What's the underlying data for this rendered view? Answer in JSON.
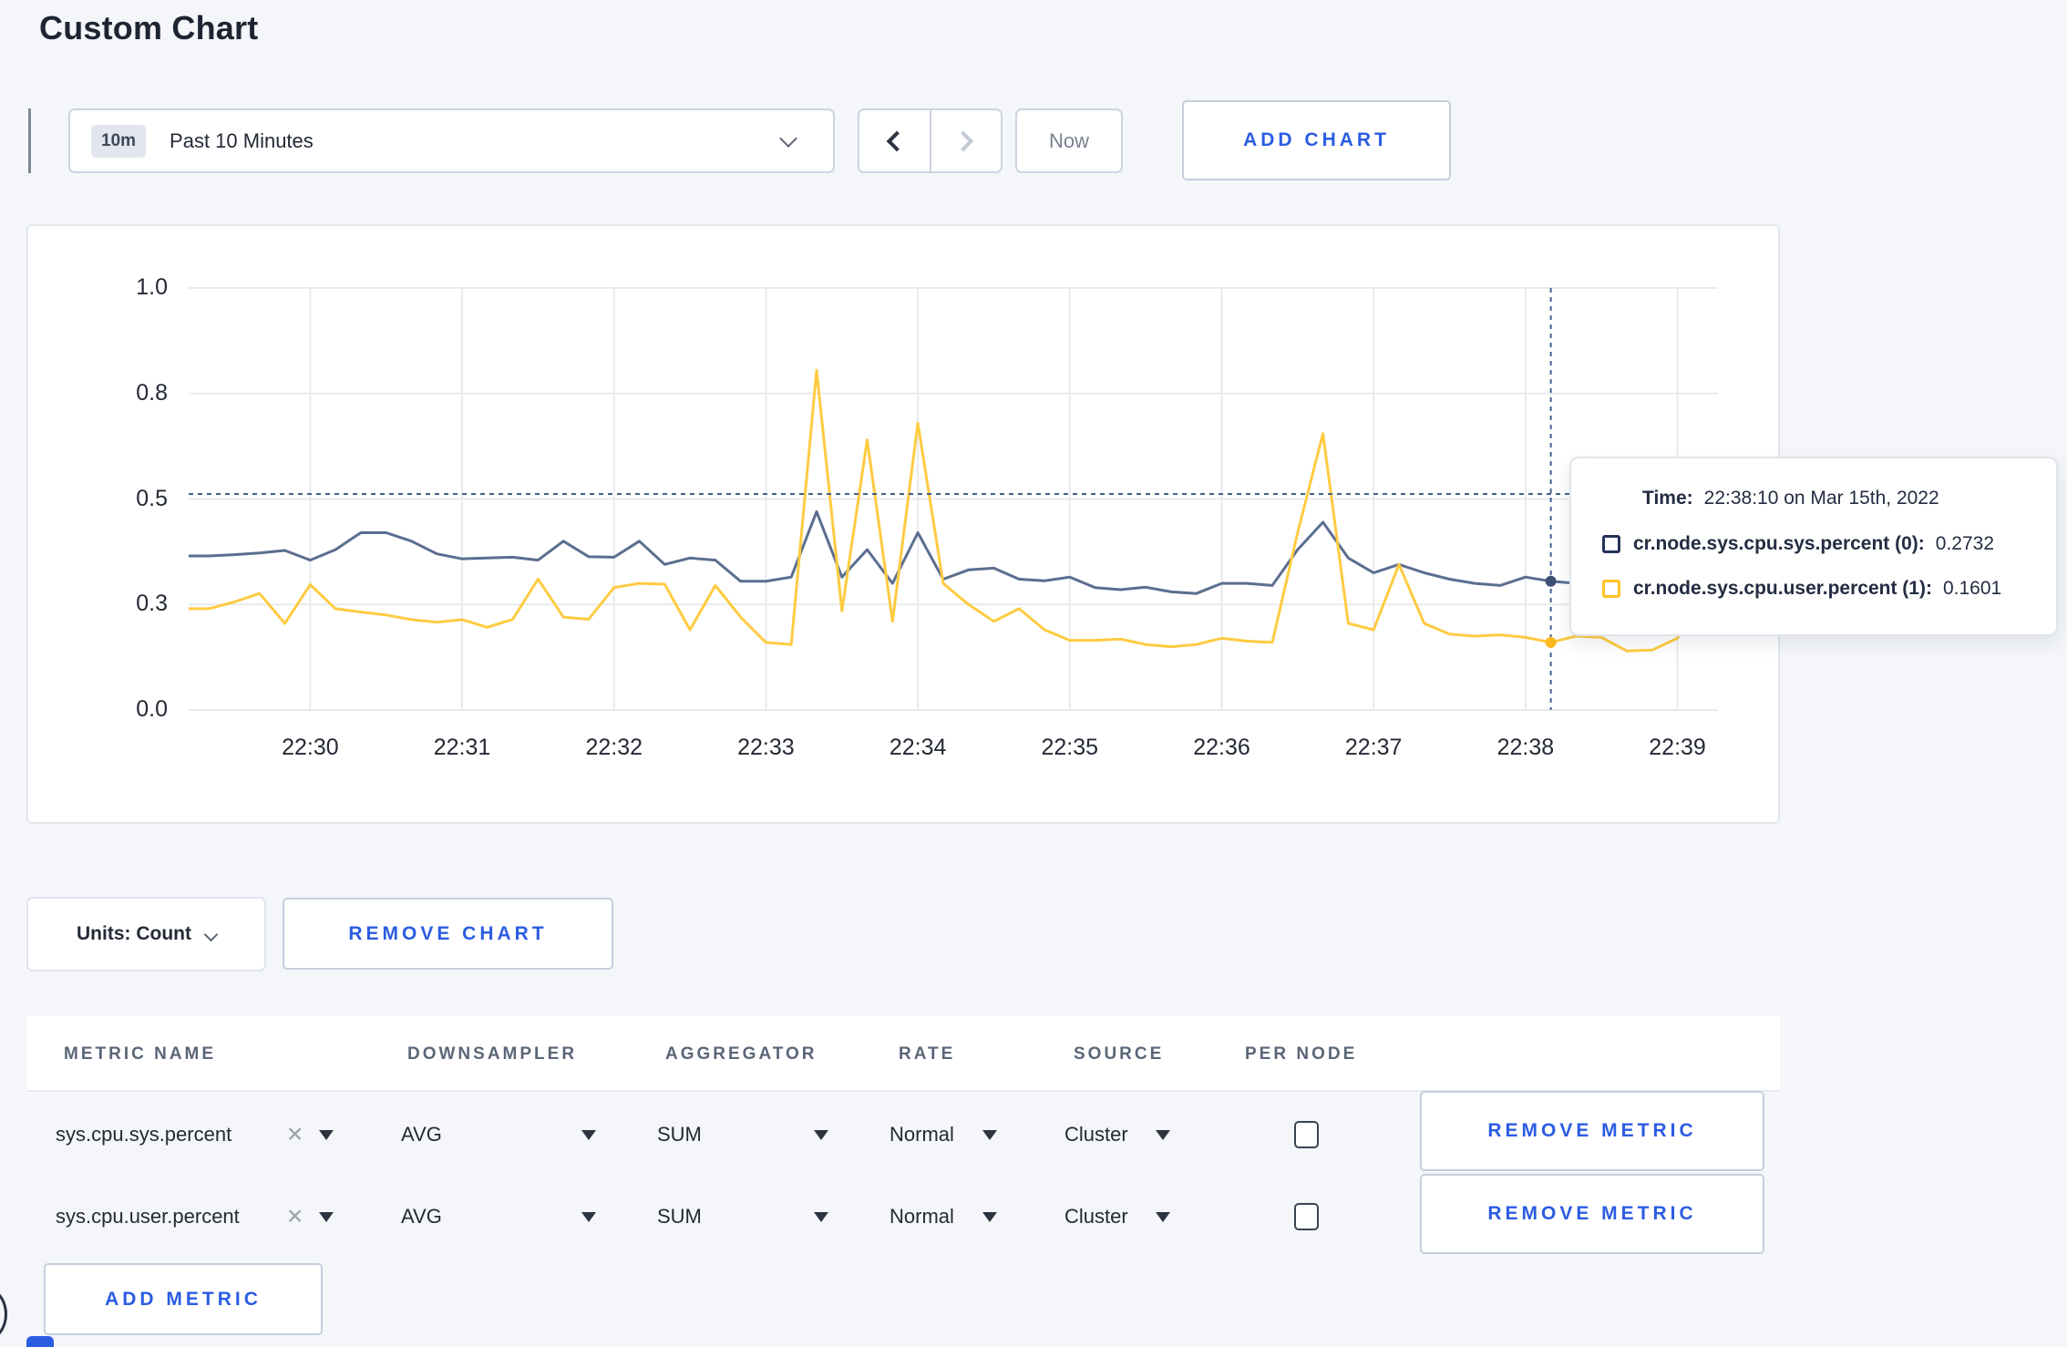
{
  "page": {
    "title": "Custom Chart"
  },
  "toolbar": {
    "time_badge": "10m",
    "time_label": "Past 10 Minutes",
    "now_label": "Now",
    "add_chart_label": "ADD CHART"
  },
  "controls": {
    "units_label": "Units: Count",
    "remove_chart_label": "REMOVE CHART",
    "add_metric_label": "ADD METRIC"
  },
  "tooltip": {
    "time_label": "Time:",
    "time_value": "22:38:10 on Mar 15th, 2022",
    "rows": [
      {
        "name": "cr.node.sys.cpu.sys.percent (0):",
        "value": "0.2732",
        "color": "#25335a"
      },
      {
        "name": "cr.node.sys.cpu.user.percent (1):",
        "value": "0.1601",
        "color": "#ffc425"
      }
    ]
  },
  "metrics_table": {
    "headers": [
      "METRIC NAME",
      "DOWNSAMPLER",
      "AGGREGATOR",
      "RATE",
      "SOURCE",
      "PER NODE"
    ],
    "rows": [
      {
        "metric": "sys.cpu.sys.percent",
        "downsampler": "AVG",
        "aggregator": "SUM",
        "rate": "Normal",
        "source": "Cluster",
        "per_node_checked": false,
        "remove_label": "REMOVE METRIC"
      },
      {
        "metric": "sys.cpu.user.percent",
        "downsampler": "AVG",
        "aggregator": "SUM",
        "rate": "Normal",
        "source": "Cluster",
        "per_node_checked": false,
        "remove_label": "REMOVE METRIC"
      }
    ]
  },
  "chart_data": {
    "type": "line",
    "title": "",
    "xlabel": "",
    "ylabel": "",
    "ylim": [
      0,
      1
    ],
    "domain_sec": [
      -48,
      556
    ],
    "x_ticks": [
      {
        "sec": 0,
        "label": "22:30"
      },
      {
        "sec": 60,
        "label": "22:31"
      },
      {
        "sec": 120,
        "label": "22:32"
      },
      {
        "sec": 180,
        "label": "22:33"
      },
      {
        "sec": 240,
        "label": "22:34"
      },
      {
        "sec": 300,
        "label": "22:35"
      },
      {
        "sec": 360,
        "label": "22:36"
      },
      {
        "sec": 420,
        "label": "22:37"
      },
      {
        "sec": 480,
        "label": "22:38"
      },
      {
        "sec": 540,
        "label": "22:39"
      }
    ],
    "y_ticks": {
      "values": [
        0,
        0.25,
        0.5,
        0.75,
        1.0
      ],
      "labels": [
        "0.0",
        "0.3",
        "0.5",
        "0.8",
        "1.0"
      ]
    },
    "times_sec": [
      -48,
      -40,
      -30,
      -20,
      -10,
      0,
      10,
      20,
      30,
      40,
      50,
      60,
      70,
      80,
      90,
      100,
      110,
      120,
      130,
      140,
      150,
      160,
      170,
      180,
      190,
      200,
      210,
      220,
      230,
      240,
      250,
      260,
      270,
      280,
      290,
      300,
      310,
      320,
      330,
      340,
      350,
      360,
      370,
      380,
      390,
      400,
      410,
      420,
      430,
      440,
      450,
      460,
      470,
      480,
      490,
      500,
      510,
      520,
      530,
      540,
      550,
      556
    ],
    "series": [
      {
        "name": "cr.node.sys.cpu.sys.percent",
        "color": "#5b6e8f",
        "dot": "#3d4f73",
        "values": [
          0.365,
          0.365,
          0.368,
          0.372,
          0.378,
          0.355,
          0.38,
          0.42,
          0.42,
          0.4,
          0.37,
          0.358,
          0.36,
          0.362,
          0.355,
          0.4,
          0.363,
          0.362,
          0.4,
          0.345,
          0.36,
          0.355,
          0.305,
          0.305,
          0.315,
          0.47,
          0.315,
          0.38,
          0.3,
          0.42,
          0.31,
          0.332,
          0.336,
          0.31,
          0.306,
          0.315,
          0.29,
          0.285,
          0.291,
          0.28,
          0.276,
          0.3,
          0.3,
          0.295,
          0.38,
          0.445,
          0.36,
          0.325,
          0.345,
          0.325,
          0.31,
          0.3,
          0.295,
          0.315,
          0.305,
          0.3,
          0.296,
          0.29,
          0.315,
          0.3,
          0.31,
          0.31
        ]
      },
      {
        "name": "cr.node.sys.cpu.user.percent",
        "color": "#fecb41",
        "dot": "#fdb81e",
        "values": [
          0.24,
          0.24,
          0.256,
          0.276,
          0.205,
          0.297,
          0.24,
          0.232,
          0.225,
          0.214,
          0.208,
          0.214,
          0.196,
          0.215,
          0.31,
          0.22,
          0.215,
          0.29,
          0.3,
          0.298,
          0.19,
          0.295,
          0.22,
          0.16,
          0.155,
          0.805,
          0.235,
          0.64,
          0.21,
          0.68,
          0.3,
          0.25,
          0.21,
          0.24,
          0.19,
          0.165,
          0.165,
          0.168,
          0.155,
          0.15,
          0.155,
          0.17,
          0.163,
          0.16,
          0.42,
          0.655,
          0.205,
          0.19,
          0.345,
          0.205,
          0.18,
          0.175,
          0.178,
          0.172,
          0.16,
          0.175,
          0.172,
          0.14,
          0.142,
          0.17,
          0.28,
          0.245
        ]
      }
    ],
    "crosshair": {
      "time_sec": 490,
      "h_value": 0.512,
      "points": [
        {
          "series": 0,
          "value": 0.305
        },
        {
          "series": 1,
          "value": 0.16
        }
      ]
    },
    "legend_position": "tooltip",
    "grid": true
  }
}
